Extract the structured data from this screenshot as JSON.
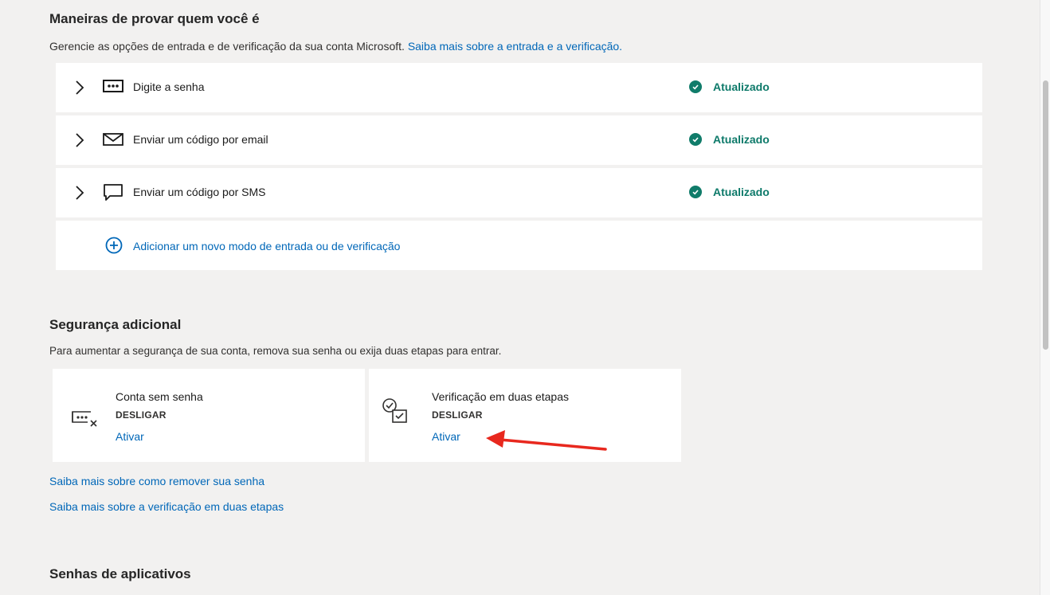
{
  "section_signin": {
    "title": "Maneiras de provar quem você é",
    "description": "Gerencie as opções de entrada e de verificação da sua conta Microsoft.",
    "learn_more_link": "Saiba mais sobre a entrada e a verificação.",
    "methods": [
      {
        "label": "Digite a senha",
        "icon": "password-dots-icon",
        "status": "Atualizado"
      },
      {
        "label": "Enviar um código por email",
        "icon": "envelope-icon",
        "status": "Atualizado"
      },
      {
        "label": "Enviar um código por SMS",
        "icon": "chat-bubble-icon",
        "status": "Atualizado"
      }
    ],
    "add_method_link": "Adicionar um novo modo de entrada ou de verificação"
  },
  "section_security": {
    "title": "Segurança adicional",
    "description": "Para aumentar a segurança de sua conta, remova sua senha ou exija duas etapas para entrar.",
    "cards": [
      {
        "title": "Conta sem senha",
        "state": "DESLIGAR",
        "action": "Ativar",
        "icon": "passwordless-icon"
      },
      {
        "title": "Verificação em duas etapas",
        "state": "DESLIGAR",
        "action": "Ativar",
        "icon": "two-step-icon"
      }
    ],
    "learn_remove_password": "Saiba mais sobre como remover sua senha",
    "learn_two_step": "Saiba mais sobre a verificação em duas etapas"
  },
  "section_app_passwords": {
    "title": "Senhas de aplicativos"
  },
  "colors": {
    "background": "#f2f1f0",
    "link": "#0067b8",
    "status_green": "#107c6a",
    "annotation_arrow": "#e8281e"
  }
}
